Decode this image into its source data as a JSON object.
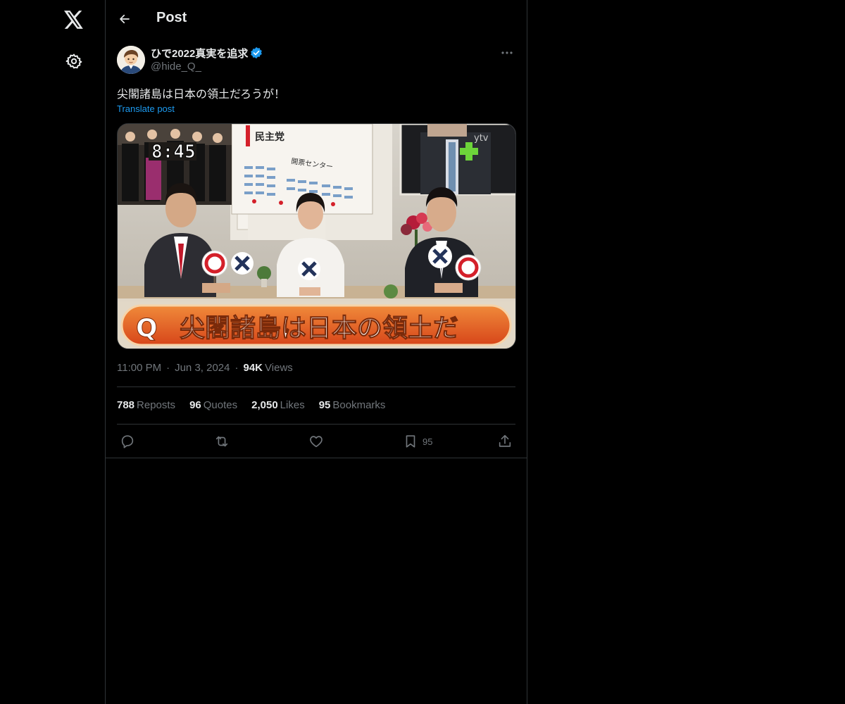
{
  "nav": {
    "logo_icon": "x-logo-icon",
    "settings_icon": "gear-icon"
  },
  "header": {
    "title": "Post"
  },
  "post": {
    "author": {
      "display_name": "ひで2022真実を追求",
      "handle": "@hide_Q_",
      "verified": true
    },
    "text": "尖閣諸島は日本の領土だろうが！",
    "translate_label": "Translate post",
    "media": {
      "clock": "8:45",
      "station_logo": "ytv",
      "party_sign": "民主党",
      "center_sign": "開票センター",
      "question_mark": "Q",
      "question_text": "尖閣諸島は日本の領土だ"
    },
    "time": "11:00 PM",
    "date": "Jun 3, 2024",
    "views_count": "94K",
    "views_label": "Views",
    "stats": {
      "reposts_count": "788",
      "reposts_label": "Reposts",
      "quotes_count": "96",
      "quotes_label": "Quotes",
      "likes_count": "2,050",
      "likes_label": "Likes",
      "bookmarks_count": "95",
      "bookmarks_label": "Bookmarks"
    },
    "actions": {
      "bookmark_count": "95"
    }
  },
  "colors": {
    "background": "#000000",
    "text_primary": "#e7e9ea",
    "text_secondary": "#71767b",
    "accent": "#1d9bf0",
    "border": "#2f3336"
  }
}
